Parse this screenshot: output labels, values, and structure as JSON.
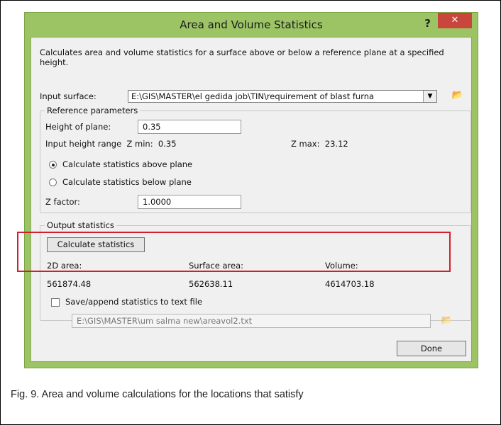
{
  "window": {
    "title": "Area and Volume Statistics",
    "help_label": "?",
    "close_label": "✕"
  },
  "description": "Calculates area and volume statistics for a surface above or below a reference plane at a specified height.",
  "input_surface": {
    "label": "Input surface:",
    "value": "E:\\GIS\\MASTER\\el gedida job\\TIN\\requirement of blast furna"
  },
  "reference": {
    "group_label": "Reference parameters",
    "height_label": "Height of plane:",
    "height_value": "0.35",
    "range_label": "Input height range",
    "zmin_label": "Z min:",
    "zmin_value": "0.35",
    "zmax_label": "Z max:",
    "zmax_value": "23.12",
    "radio_above": "Calculate statistics above plane",
    "radio_below": "Calculate statistics below plane",
    "zfactor_label": "Z factor:",
    "zfactor_value": "1.0000"
  },
  "output": {
    "group_label": "Output statistics",
    "calc_button": "Calculate statistics",
    "area2d_label": "2D area:",
    "area2d_value": "561874.48",
    "surface_label": "Surface area:",
    "surface_value": "562638.11",
    "volume_label": "Volume:",
    "volume_value": "4614703.18",
    "save_label": "Save/append statistics to text file",
    "save_path": "E:\\GIS\\MASTER\\um salma new\\areavol2.txt"
  },
  "done_button": "Done",
  "caption": "Fig. 9. Area and volume calculations for the locations that satisfy",
  "colors": {
    "frame": "#9cc465",
    "close": "#c9463d",
    "highlight": "#d0202d"
  }
}
